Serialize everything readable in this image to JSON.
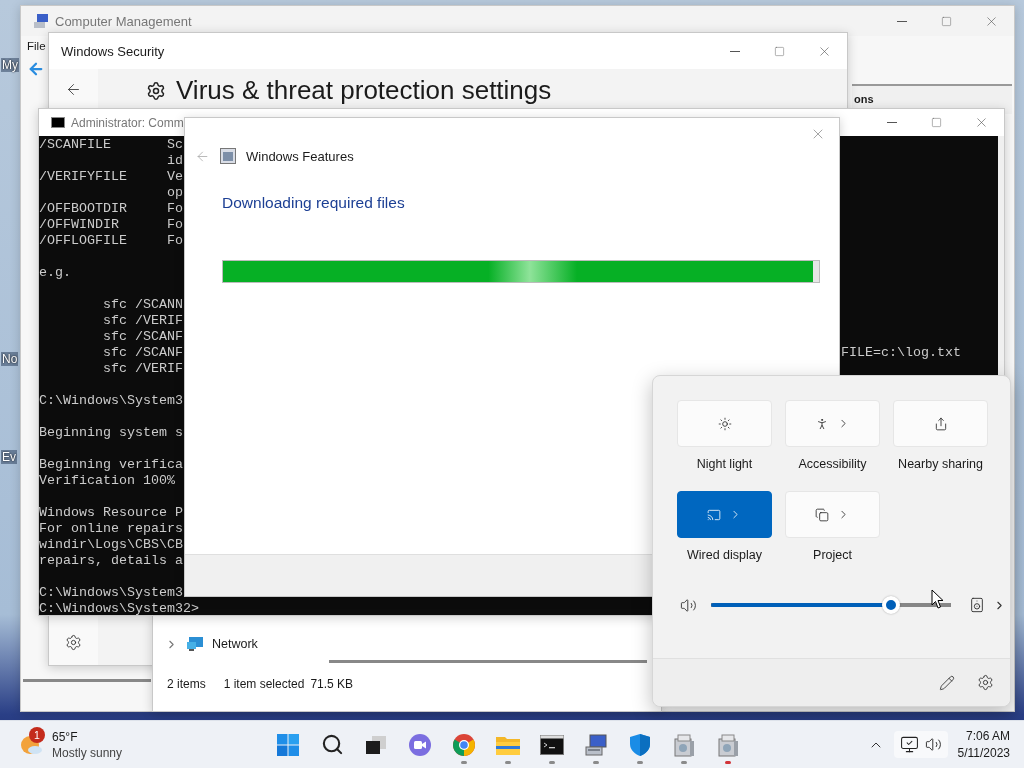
{
  "desktop": {
    "icon_labels": [
      "My",
      "No",
      "Ev"
    ]
  },
  "computer_management": {
    "title": "Computer Management",
    "menu": [
      "File"
    ],
    "actions_fragment": "ons"
  },
  "windows_security": {
    "title": "Windows Security",
    "heading": "Virus & threat protection settings"
  },
  "command_prompt": {
    "title": "Administrator: Comm",
    "blocks": [
      [
        "/SCANFILE       Sc",
        "                id",
        "/VERIFYFILE     Ve",
        "                op",
        "/OFFBOOTDIR     Fo",
        "/OFFWINDIR      Fo",
        "/OFFLOGFILE     Fo"
      ],
      [
        "e.g."
      ],
      [
        "        sfc /SCANN",
        "        sfc /VERIF",
        "        sfc /SCANF",
        "        sfc /SCANF",
        "        sfc /VERIF"
      ],
      [
        "C:\\Windows\\System3"
      ],
      [
        "Beginning system s"
      ],
      [
        "Beginning verifica",
        "Verification 100%"
      ],
      [
        "Windows Resource P",
        "For online repairs",
        "windir\\Logs\\CBS\\CB",
        "repairs, details a"
      ],
      [
        "C:\\Windows\\System3",
        "C:\\Windows\\System32>"
      ]
    ],
    "right_fragment": "FILE=c:\\log.txt"
  },
  "windows_features": {
    "title": "Windows Features",
    "status": "Downloading required files",
    "progress": {
      "level": 0.99
    }
  },
  "file_explorer": {
    "tree_item": "Network",
    "item_count": "2 items",
    "selection": "1 item selected",
    "size": "71.5 KB"
  },
  "quick_settings": {
    "tiles": [
      {
        "label": "Night light",
        "on": false,
        "chevron": false
      },
      {
        "label": "Accessibility",
        "on": false,
        "chevron": true
      },
      {
        "label": "Nearby sharing",
        "on": false,
        "chevron": false
      },
      {
        "label": "Wired display",
        "on": true,
        "chevron": true
      },
      {
        "label": "Project",
        "on": false,
        "chevron": true
      }
    ],
    "volume": {
      "level": 0.75
    }
  },
  "taskbar": {
    "weather": {
      "badge": "1",
      "temperature": "65°F",
      "condition": "Mostly sunny"
    },
    "apps": [
      {
        "running": false,
        "attention": false
      },
      {
        "running": false,
        "attention": false
      },
      {
        "running": false,
        "attention": false
      },
      {
        "running": false,
        "attention": false
      },
      {
        "running": true,
        "attention": false
      },
      {
        "running": true,
        "attention": false
      },
      {
        "running": true,
        "attention": false
      },
      {
        "running": true,
        "attention": false
      },
      {
        "running": true,
        "attention": false
      },
      {
        "running": true,
        "attention": false
      },
      {
        "running": true,
        "attention": true
      }
    ],
    "tray": {
      "time": "7:06 AM",
      "date": "5/11/2023"
    }
  }
}
